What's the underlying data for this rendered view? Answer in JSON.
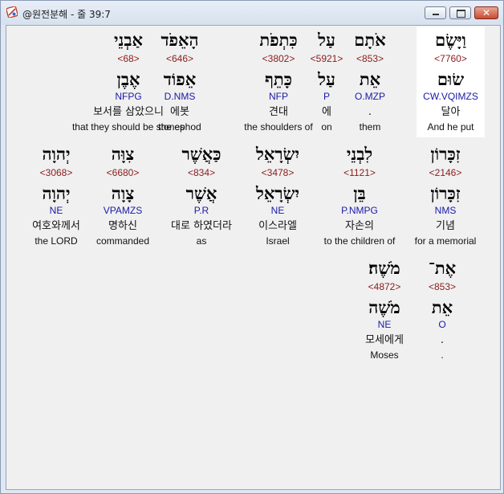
{
  "window": {
    "title": "@원전분해 - 줄 39:7",
    "close_glyph": "✕"
  },
  "rows": [
    {
      "words": [
        {
          "hebrew": "וַיָּשֶׂם",
          "strong": "<7760>",
          "lemma": "שׂוּם",
          "morph": "CW.VQIMZS",
          "korean": "달아",
          "english": "And he put",
          "highlight": true
        },
        {
          "hebrew": "אֹתָם",
          "strong": "<853>",
          "lemma": "אֵת",
          "morph": "O.MZP",
          "korean": ".",
          "english": "them",
          "highlight": false
        },
        {
          "hebrew": "עַל",
          "strong": "<5921>",
          "lemma": "עַל",
          "morph": "P",
          "korean": "에",
          "english": "on",
          "highlight": false
        },
        {
          "hebrew": "כִּתְפֹת",
          "strong": "<3802>",
          "lemma": "כָּתֵף",
          "morph": "NFP",
          "korean": "견대",
          "english": "the shoulders of",
          "highlight": false
        },
        {
          "hebrew": "הָאֵפֹד",
          "strong": "<646>",
          "lemma": "אֵפוֹד",
          "morph": "D.NMS",
          "korean": "에봇",
          "english": "the ephod",
          "highlight": false
        },
        {
          "hebrew": "אַבְנֵי",
          "strong": "<68>",
          "lemma": "אֶבֶן",
          "morph": "NFPG",
          "korean": "보서를 삼았으니",
          "english": "that they should be stones",
          "highlight": false
        }
      ]
    },
    {
      "words": [
        {
          "hebrew": "זִכָּרוֹן",
          "strong": "<2146>",
          "lemma": "זִכָּרוֹן",
          "morph": "NMS",
          "korean": "기념",
          "english": "for a memorial",
          "highlight": false
        },
        {
          "hebrew": "לִבְנֵי",
          "strong": "<1121>",
          "lemma": "בֵּן",
          "morph": "P.NMPG",
          "korean": "자손의",
          "english": "to the children of",
          "highlight": false
        },
        {
          "hebrew": "יִשְׂרָאֵל",
          "strong": "<3478>",
          "lemma": "יִשְׂרָאֵל",
          "morph": "NE",
          "korean": "이스라엘",
          "english": "Israel",
          "highlight": false
        },
        {
          "hebrew": "כַּאֲשֶׁר",
          "strong": "<834>",
          "lemma": "אֲשֶׁר",
          "morph": "P.R",
          "korean": "대로 하였더라",
          "english": "as",
          "highlight": false
        },
        {
          "hebrew": "צִוָּה",
          "strong": "<6680>",
          "lemma": "צָוָה",
          "morph": "VPAMZS",
          "korean": "명하신",
          "english": "commanded",
          "highlight": false
        },
        {
          "hebrew": "יְהוָה",
          "strong": "<3068>",
          "lemma": "יְהוָה",
          "morph": "NE",
          "korean": "여호와께서",
          "english": "the LORD",
          "highlight": false
        }
      ]
    },
    {
      "words": [
        {
          "hebrew": "אֶת־",
          "strong": "<853>",
          "lemma": "אֵת",
          "morph": "O",
          "korean": ".",
          "english": ".",
          "highlight": false
        },
        {
          "hebrew": "מֹשֶׁה׃",
          "strong": "<4872>",
          "lemma": "מֹשֶׁה",
          "morph": "NE",
          "korean": "모세에게",
          "english": "Moses",
          "highlight": false
        }
      ]
    }
  ]
}
